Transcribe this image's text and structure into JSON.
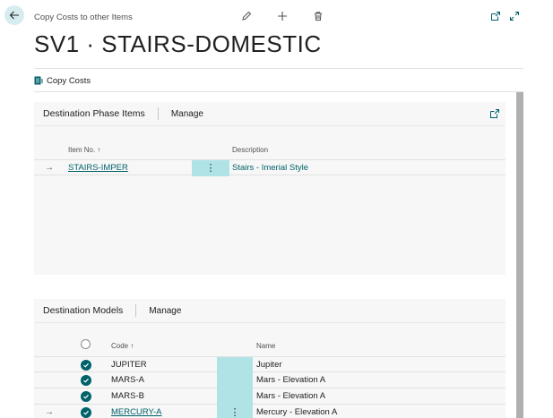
{
  "header": {
    "breadcrumb": "Copy Costs to other Items",
    "title": "SV1 · STAIRS-DOMESTIC"
  },
  "actions": {
    "copy_costs": "Copy Costs"
  },
  "phase_items": {
    "title": "Destination Phase Items",
    "manage": "Manage",
    "col_item": "Item No. ↑",
    "col_desc": "Description",
    "rows": [
      {
        "item_no": "STAIRS-IMPER",
        "description": "Stairs - Imerial Style"
      }
    ]
  },
  "models": {
    "title": "Destination Models",
    "manage": "Manage",
    "col_code": "Code ↑",
    "col_name": "Name",
    "rows": [
      {
        "code": "JUPITER",
        "name": "Jupiter"
      },
      {
        "code": "MARS-A",
        "name": "Mars - Elevation A"
      },
      {
        "code": "MARS-B",
        "name": "Mars - Elevation A"
      },
      {
        "code": "MERCURY-A",
        "name": "Mercury - Elevation A"
      }
    ]
  },
  "colors": {
    "accent": "#00616a",
    "selected_cell": "#b0e3e6"
  }
}
